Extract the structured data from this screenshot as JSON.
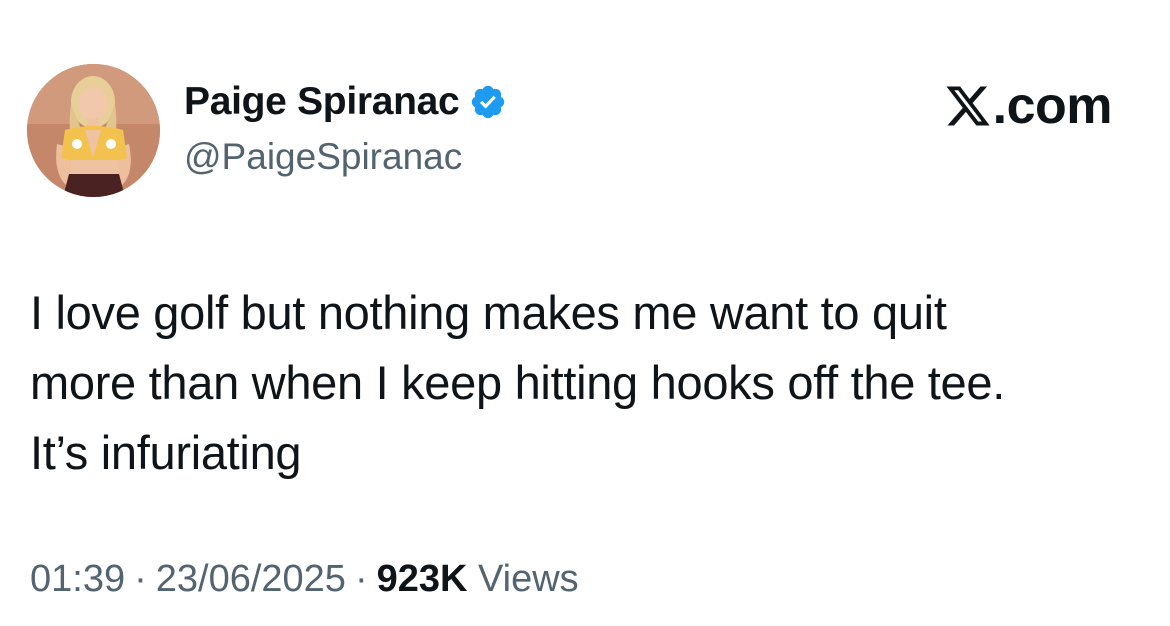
{
  "author": {
    "display_name": "Paige Spiranac",
    "handle": "@PaigeSpiranac",
    "verified": true,
    "verified_icon": "verified-badge-icon",
    "avatar_icon": "profile-photo"
  },
  "brand": {
    "logo_icon": "x-logo-icon",
    "suffix": ".com"
  },
  "tweet": {
    "text": "I love golf but nothing makes me want to quit\nmore than when I keep hitting hooks off the tee.\nIt’s infuriating"
  },
  "meta": {
    "time": "01:39",
    "separator": "·",
    "date": "23/06/2025",
    "views_count": "923K",
    "views_label": "Views"
  },
  "colors": {
    "text": "#0f1419",
    "secondary": "#536471",
    "verified": "#1d9bf0"
  }
}
